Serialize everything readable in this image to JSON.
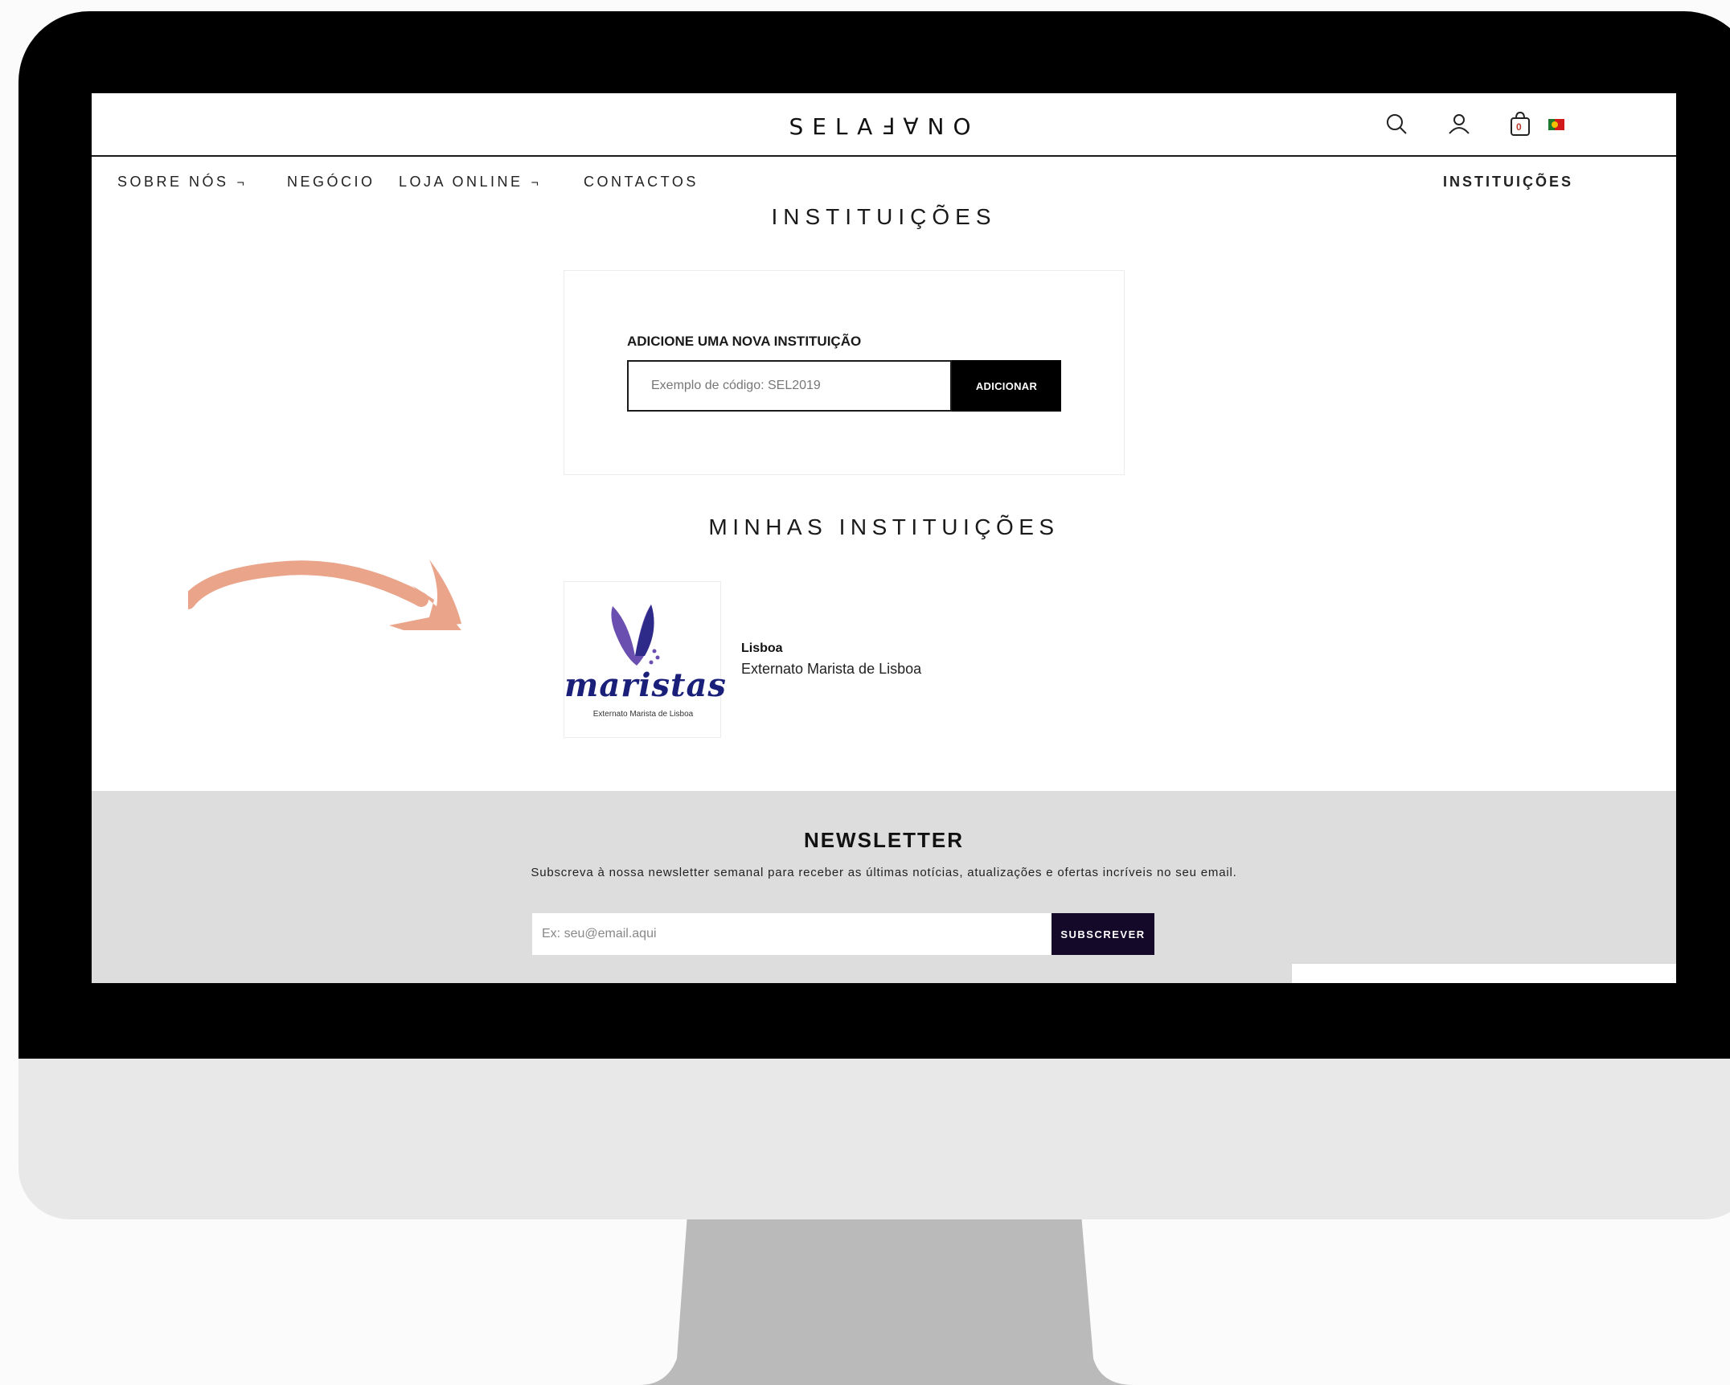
{
  "header": {
    "logo": "SELAℲ∀ΝO",
    "icons": [
      "search-icon",
      "user-icon",
      "cart-icon",
      "flag-portugal-icon"
    ],
    "cart_count": "0"
  },
  "nav": {
    "items": [
      {
        "label": "SOBRE NÓS",
        "caret": "¬"
      },
      {
        "label": "NEGÓCIO"
      },
      {
        "label": "LOJA ONLINE",
        "caret": "¬"
      },
      {
        "label": "CONTACTOS"
      }
    ],
    "right_item": "INSTITUIÇÕES"
  },
  "page": {
    "title": "INSTITUIÇÕES"
  },
  "add_institution": {
    "label": "ADICIONE UMA NOVA INSTITUIÇÃO",
    "placeholder": "Exemplo de código: SEL2019",
    "button": "ADICIONAR"
  },
  "my_institutions": {
    "title": "MINHAS INSTITUIÇÕES",
    "items": [
      {
        "logo_text": "maristas",
        "logo_caption": "Externato Marista de Lisboa",
        "city": "Lisboa",
        "name": "Externato Marista de Lisboa"
      }
    ]
  },
  "newsletter": {
    "title": "NEWSLETTER",
    "description": "Subscreva à nossa newsletter semanal para receber as últimas notícias, atualizações e ofertas incríveis no seu email.",
    "placeholder": "Ex: seu@email.aqui",
    "button": "SUBSCREVER"
  },
  "colors": {
    "arrow": "#e9a48a",
    "newsletter_bg": "#dddddd",
    "subscribe_button": "#15092a",
    "logo_blue": "#1a1f7a",
    "logo_purple": "#6a4fb0"
  }
}
